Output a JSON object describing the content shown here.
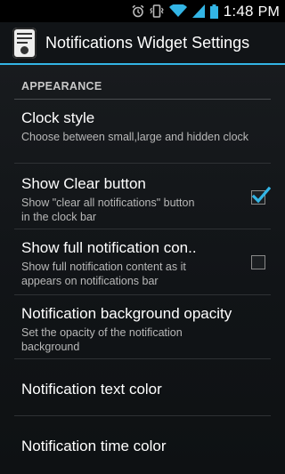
{
  "status_bar": {
    "time": "1:48",
    "ampm": "PM",
    "icons": [
      "alarm-icon",
      "vibrate-icon",
      "wifi-icon",
      "signal-icon",
      "battery-icon"
    ]
  },
  "action_bar": {
    "title": "Notifications Widget Settings",
    "icon": "notification-widget-app-icon",
    "accent_color": "#33b5e5"
  },
  "category": {
    "label": "APPEARANCE"
  },
  "preferences": [
    {
      "title": "Clock style",
      "summary": "Choose between small,large and hidden clock"
    },
    {
      "title": "Show Clear button",
      "summary": "Show \"clear all notifications\" button in the clock bar",
      "checked": true
    },
    {
      "title": "Show full notification con..",
      "summary": "Show full notification content as it appears on notifications bar",
      "checked": false
    },
    {
      "title": "Notification background opacity",
      "summary": "Set the opacity of the notification background"
    },
    {
      "title": "Notification text color"
    },
    {
      "title": "Notification time color"
    }
  ]
}
